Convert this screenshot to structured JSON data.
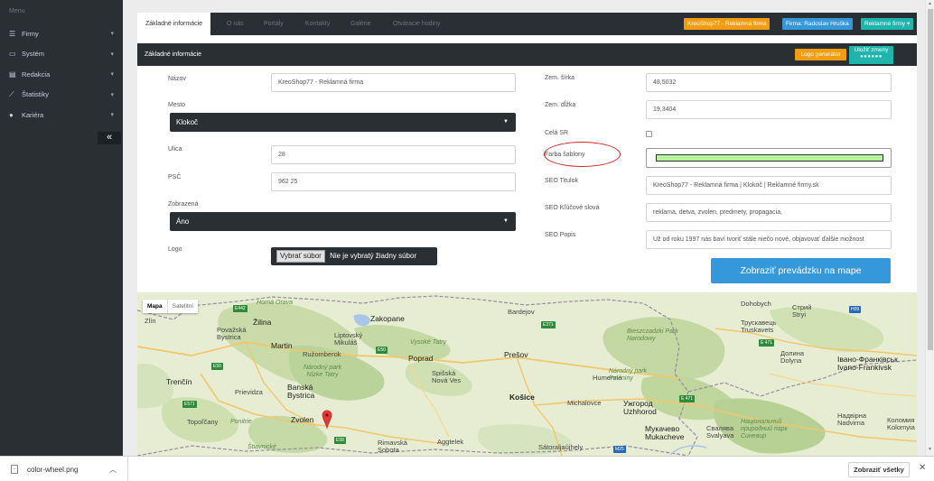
{
  "sidebar": {
    "menu_title": "Menu",
    "items": [
      {
        "label": "Firmy",
        "icon": "list-icon"
      },
      {
        "label": "Systém",
        "icon": "monitor-icon"
      },
      {
        "label": "Redakcia",
        "icon": "newspaper-icon"
      },
      {
        "label": "Štatistiky",
        "icon": "chart-icon"
      },
      {
        "label": "Kariéra",
        "icon": "user-icon"
      }
    ],
    "collapse_glyph": "«"
  },
  "tabs": [
    "Základné informácie",
    "O nás",
    "Portály",
    "Kontakty",
    "Galérie",
    "Otváracie hodiny"
  ],
  "badges": {
    "shop": "KreoShop77 - Reklamná firma",
    "owner": "Firma: Radoslav Hruška",
    "type": "Reklamné firmy ▾",
    "shop_color": "#f39c12",
    "owner_color": "#3498db",
    "type_color": "#1fb5ac"
  },
  "panel": {
    "title": "Základné informácie",
    "logo_generator": "Logo generátor",
    "save_label": "Uložiť zmeny",
    "save_dots": "●●●●●●"
  },
  "form": {
    "nazov_label": "Názov",
    "nazov_value": "KreoShop77 - Reklamná firma",
    "mesto_label": "Mesto",
    "mesto_value": "Klokoč",
    "ulica_label": "Ulica",
    "ulica_value": "28",
    "psc_label": "PSČ",
    "psc_value": "962 25",
    "zobrazena_label": "Zobrazená",
    "zobrazena_value": "Áno",
    "logo_label": "Logo",
    "file_button": "Vybrať súbor",
    "file_status": "Nie je vybratý žiadny súbor",
    "sirka_label": "Zem. šírka",
    "sirka_value": "48,5032",
    "dlzka_label": "Zem. dĺžka",
    "dlzka_value": "19,3404",
    "cela_sr_label": "Celá SR",
    "farba_label": "Farba šablony",
    "farba_color": "#b6f29a",
    "seo_titulok_label": "SEO Titulok",
    "seo_titulok_value": "KreoShop77 - Reklamná firma | Klokoč | Reklamné firmy.sk",
    "seo_klucove_label": "SEO Kľúčové slová",
    "seo_klucove_value": "reklama, detva, zvolen, predmety, propagacia,",
    "seo_popis_label": "SEO Popis",
    "seo_popis_value": "Už od roku 1997 nás baví tvoriť stále niečo nové, objavovať ďalšie možnost",
    "map_button": "Zobraziť prevádzku na mape"
  },
  "map": {
    "type_map": "Mapa",
    "type_sat": "Satelitní",
    "labels": [
      {
        "t": "Zlín",
        "c": ""
      },
      {
        "t": "Žilina",
        "c": "big"
      },
      {
        "t": "Považská Bystrica",
        "c": ""
      },
      {
        "t": "Martin",
        "c": "big"
      },
      {
        "t": "Ružomberok",
        "c": ""
      },
      {
        "t": "Liptovský Mikuláš",
        "c": ""
      },
      {
        "t": "Zakopane",
        "c": "big"
      },
      {
        "t": "Poprad",
        "c": "big"
      },
      {
        "t": "Prešov",
        "c": "big"
      },
      {
        "t": "Spišská Nová Ves",
        "c": ""
      },
      {
        "t": "Košice",
        "c": "big"
      },
      {
        "t": "Trenčín",
        "c": "big"
      },
      {
        "t": "Prievidza",
        "c": ""
      },
      {
        "t": "Banská Bystrica",
        "c": "big"
      },
      {
        "t": "Zvolen",
        "c": "big"
      },
      {
        "t": "Topoľčany",
        "c": ""
      },
      {
        "t": "Rimavská Sobota",
        "c": ""
      },
      {
        "t": "Humenné",
        "c": ""
      },
      {
        "t": "Michalovce",
        "c": ""
      },
      {
        "t": "Bardejov",
        "c": ""
      },
      {
        "t": "Ужгород Uzhhorod",
        "c": "big"
      },
      {
        "t": "Мукачево Mukacheve",
        "c": "big"
      },
      {
        "t": "Стрий Stryi",
        "c": ""
      },
      {
        "t": "Трускавець Truskavets",
        "c": ""
      },
      {
        "t": "Долина Dolyna",
        "c": ""
      },
      {
        "t": "Івано-Франківськ Ivano-Frankivsk",
        "c": "big"
      },
      {
        "t": "Надвірна Nadvirna",
        "c": ""
      },
      {
        "t": "Коломия Kolomyia",
        "c": ""
      },
      {
        "t": "Свалява Svalyava",
        "c": ""
      },
      {
        "t": "Národný park Nízke Tatry",
        "c": "it"
      },
      {
        "t": "Horná Orava",
        "c": "it"
      },
      {
        "t": "Vysoké Tatry",
        "c": "it"
      },
      {
        "t": "Bieszczadzki Park Narodowy",
        "c": "it"
      },
      {
        "t": "Národný park Poloniny",
        "c": "it"
      },
      {
        "t": "Національний природний парк Синевир",
        "c": "it"
      },
      {
        "t": "Ponitrie",
        "c": "it"
      },
      {
        "t": "Štiavnické",
        "c": "it"
      },
      {
        "t": "Dohobych",
        "c": ""
      },
      {
        "t": "Sátoraljaújhely",
        "c": ""
      },
      {
        "t": "Aggtelek",
        "c": ""
      }
    ]
  },
  "download": {
    "file": "color-wheel.png",
    "show_all": "Zobraziť všetky",
    "close": "✕"
  }
}
